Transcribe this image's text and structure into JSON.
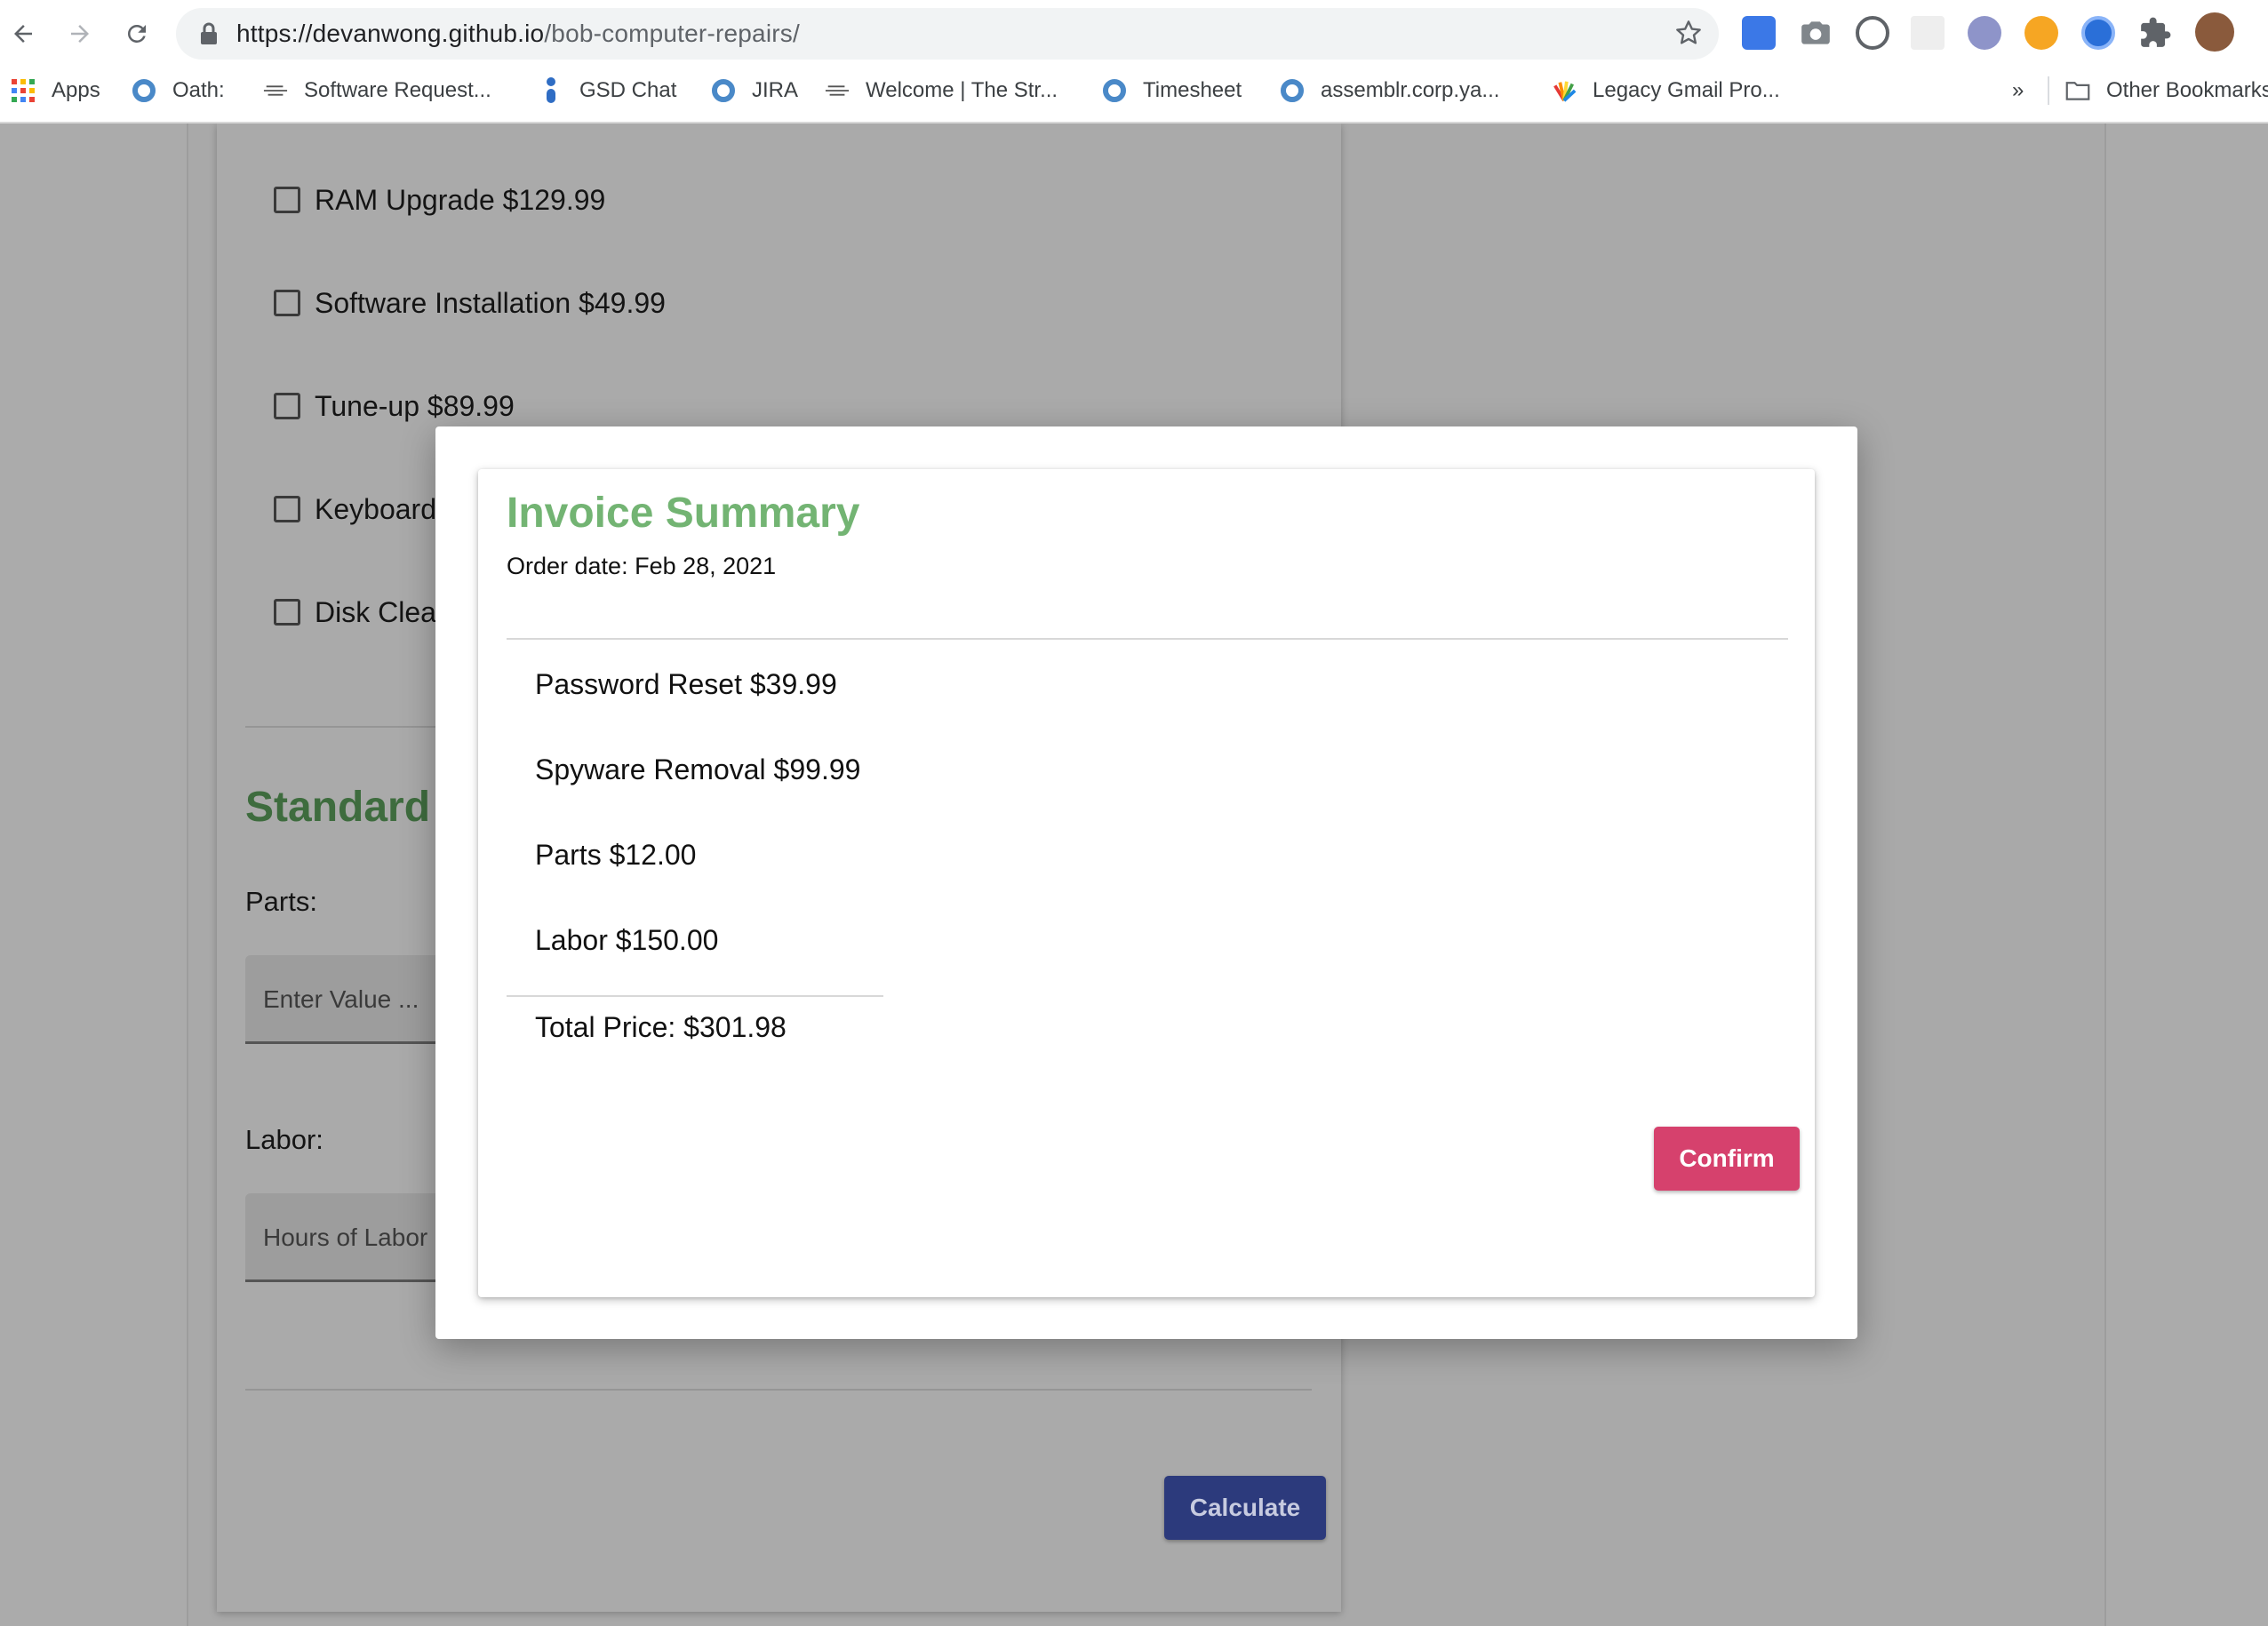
{
  "browser": {
    "url_host": "https://devanwong.github.io",
    "url_path": "/bob-computer-repairs/",
    "bookmarks": [
      {
        "label": "Apps",
        "icon": "apps-grid-icon"
      },
      {
        "label": "Oath:",
        "icon": "ring-icon"
      },
      {
        "label": "Software Request...",
        "icon": "page-icon"
      },
      {
        "label": "GSD Chat",
        "icon": "chat-icon"
      },
      {
        "label": "JIRA",
        "icon": "ring-icon"
      },
      {
        "label": "Welcome | The Str...",
        "icon": "page-icon"
      },
      {
        "label": "Timesheet",
        "icon": "ring-icon"
      },
      {
        "label": "assemblr.corp.ya...",
        "icon": "ring-icon"
      },
      {
        "label": "Legacy Gmail Pro...",
        "icon": "peacock-icon"
      }
    ],
    "more_bookmarks": "»",
    "other_bookmarks": "Other Bookmarks"
  },
  "form": {
    "services": [
      "RAM Upgrade $129.99",
      "Software Installation $49.99",
      "Tune-up $89.99",
      "Keyboard",
      "Disk Clea"
    ],
    "section_heading": "Standard I",
    "parts_label": "Parts:",
    "parts_placeholder": "Enter Value ...",
    "labor_label": "Labor:",
    "labor_placeholder": "Hours of Labor",
    "calculate_button": "Calculate"
  },
  "invoice": {
    "title": "Invoice Summary",
    "order_date": "Order date: Feb 28, 2021",
    "items": [
      "Password Reset $39.99",
      "Spyware Removal $99.99",
      "Parts $12.00",
      "Labor $150.00"
    ],
    "total": "Total Price: $301.98",
    "confirm_button": "Confirm"
  },
  "colors": {
    "invoice_title": "#73b473",
    "confirm": "#d6416d",
    "calculate": "#2c3a7c",
    "section_heading": "#3e6c3e"
  }
}
